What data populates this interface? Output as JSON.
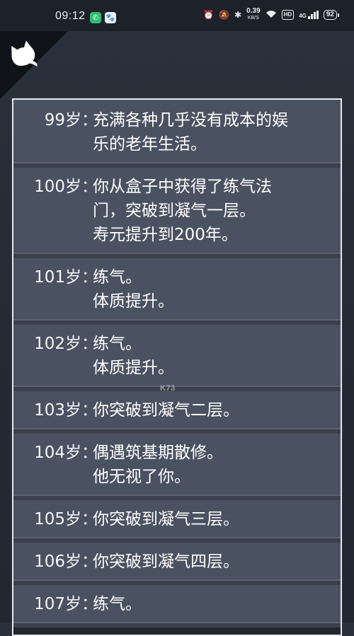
{
  "status_bar": {
    "time": "09:12",
    "net_speed_value": "0.39",
    "net_speed_unit": "KB/S",
    "hd_label": "HD",
    "network_label": "4G",
    "battery": "92"
  },
  "watermark": "K73",
  "log": {
    "entries": [
      {
        "age": "99岁",
        "text": "充满各种几乎没有成本的娱\n乐的老年生活。"
      },
      {
        "age": "100岁",
        "text": "你从盒子中获得了练气法\n门，突破到凝气一层。\n寿元提升到200年。"
      },
      {
        "age": "101岁",
        "text": "练气。\n体质提升。"
      },
      {
        "age": "102岁",
        "text": "练气。\n体质提升。"
      },
      {
        "age": "103岁",
        "text": "你突破到凝气二层。"
      },
      {
        "age": "104岁",
        "text": "偶遇筑基期散修。\n他无视了你。"
      },
      {
        "age": "105岁",
        "text": "你突破到凝气三层。"
      },
      {
        "age": "106岁",
        "text": "你突破到凝气四层。"
      },
      {
        "age": "107岁",
        "text": "练气。"
      }
    ],
    "separator": "："
  }
}
